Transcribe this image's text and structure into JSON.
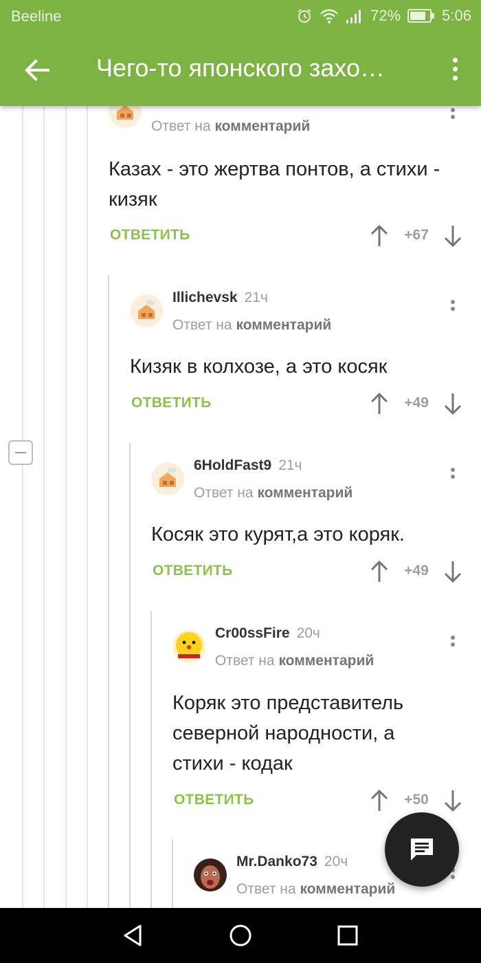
{
  "status_bar": {
    "carrier": "Beeline",
    "battery": "72%",
    "time": "5:06",
    "icons": [
      "alarm-icon",
      "wifi-icon",
      "signal-icon",
      "battery-icon"
    ]
  },
  "app_bar": {
    "title": "Чего-то японского захо…",
    "back_icon": "arrow-back-icon",
    "menu_icon": "more-vert-icon"
  },
  "colors": {
    "accent": "#7cb342",
    "reply": "#8bc34a",
    "fab": "#222222"
  },
  "comments": [
    {
      "username": "",
      "time": "",
      "reply_prefix": "Ответ на",
      "reply_target": "комментарий",
      "text": "Казах - это жертва понтов, а стихи - кизяк",
      "reply_label": "ОТВЕТИТЬ",
      "rating": "+67",
      "avatar": "house-avatar"
    },
    {
      "username": "Illichevsk",
      "time": "21ч",
      "reply_prefix": "Ответ на",
      "reply_target": "комментарий",
      "text": "Кизяк в колхозе, а это косяк",
      "reply_label": "ОТВЕТИТЬ",
      "rating": "+49",
      "avatar": "house-avatar"
    },
    {
      "username": "6HoldFast9",
      "time": "21ч",
      "reply_prefix": "Ответ на",
      "reply_target": "комментарий",
      "text": "Косяк это курят,а это коряк.",
      "reply_label": "ОТВЕТИТЬ",
      "rating": "+49",
      "avatar": "house-avatar"
    },
    {
      "username": "Cr00ssFire",
      "time": "20ч",
      "reply_prefix": "Ответ на",
      "reply_target": "комментарий",
      "text": "Коряк это представитель северной народности, а стихи - кодак",
      "reply_label": "ОТВЕТИТЬ",
      "rating": "+50",
      "avatar": "smiley-avatar"
    },
    {
      "username": "Mr.Danko73",
      "time": "20ч",
      "reply_prefix": "Ответ на",
      "reply_target": "комментарий",
      "avatar": "face-photo-avatar"
    }
  ],
  "fab": {
    "icon": "comment-icon"
  },
  "nav_bar": {
    "icons": [
      "nav-back-icon",
      "nav-home-icon",
      "nav-recents-icon"
    ]
  }
}
